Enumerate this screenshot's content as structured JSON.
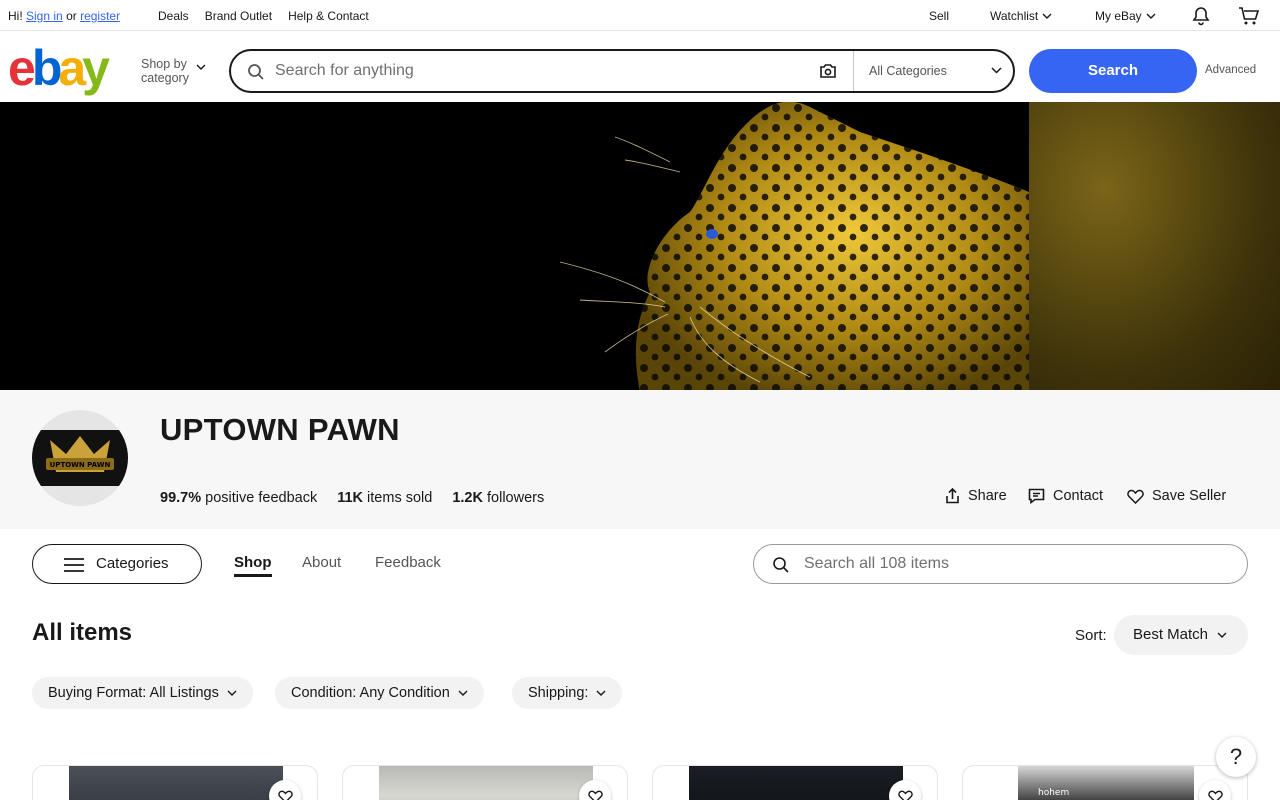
{
  "topbar": {
    "greeting": "Hi!",
    "sign_in": "Sign in",
    "or": "or",
    "register": "register",
    "links": [
      "Deals",
      "Brand Outlet",
      "Help & Contact"
    ],
    "sell": "Sell",
    "watchlist": "Watchlist",
    "my_ebay": "My eBay"
  },
  "header": {
    "logo_letters": [
      "e",
      "b",
      "a",
      "y"
    ],
    "shop_by_line1": "Shop by",
    "shop_by_line2": "category",
    "search_placeholder": "Search for anything",
    "category_select": "All Categories",
    "search_button": "Search",
    "advanced": "Advanced"
  },
  "seller": {
    "name": "UPTOWN PAWN",
    "avatar_text": "UPTOWN PAWN",
    "feedback_value": "99.7%",
    "feedback_label": "positive feedback",
    "sold_value": "11K",
    "sold_label": "items sold",
    "followers_value": "1.2K",
    "followers_label": "followers",
    "share": "Share",
    "contact": "Contact",
    "save_seller": "Save Seller"
  },
  "nav": {
    "categories": "Categories",
    "tabs": [
      "Shop",
      "About",
      "Feedback"
    ],
    "active_tab": "Shop",
    "store_search_placeholder": "Search all 108 items"
  },
  "items": {
    "heading": "All items",
    "sort_label": "Sort:",
    "sort_value": "Best Match",
    "filters": [
      "Buying Format: All Listings",
      "Condition: Any Condition",
      "Shipping:"
    ],
    "card_label": "hohem"
  },
  "help": "?",
  "colors": {
    "accent": "#3665f3",
    "text": "#191919",
    "logo_e": "#e53238",
    "logo_b": "#0064d2",
    "logo_a": "#f5af02",
    "logo_y": "#86b817"
  }
}
